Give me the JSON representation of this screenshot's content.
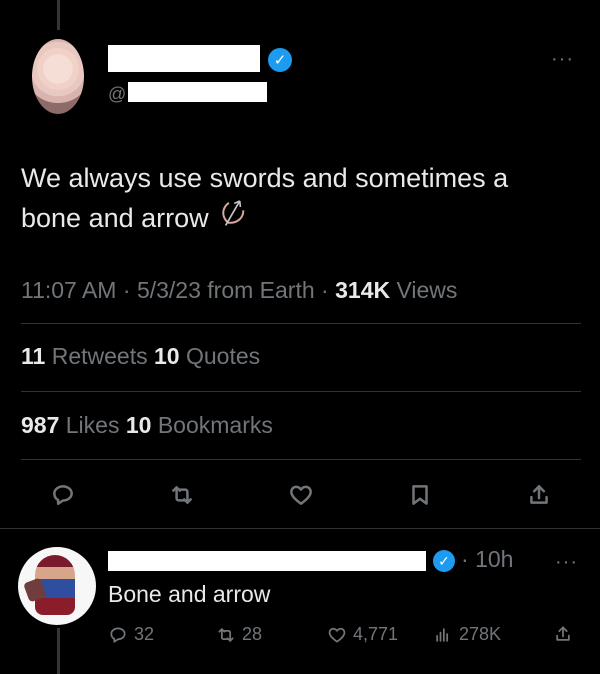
{
  "tweet": {
    "handle_prefix": "@",
    "text_line1": "We always use swords and sometimes a",
    "text_line2": "bone and arrow",
    "time": "11:07 AM",
    "date": "5/3/23",
    "location": "from Earth",
    "views_count": "314K",
    "views_label": "Views",
    "retweets_count": "11",
    "retweets_label": "Retweets",
    "quotes_count": "10",
    "quotes_label": "Quotes",
    "likes_count": "987",
    "likes_label": "Likes",
    "bookmarks_count": "10",
    "bookmarks_label": "Bookmarks",
    "verified_color": "#1d9bf0"
  },
  "reply": {
    "time": "10h",
    "text": "Bone and arrow",
    "replies": "32",
    "retweets": "28",
    "likes": "4,771",
    "views": "278K"
  },
  "icons": {
    "main_actions": [
      "reply-icon",
      "retweet-icon",
      "like-icon",
      "bookmark-icon",
      "share-icon"
    ],
    "emoji": "bow-and-arrow-emoji",
    "more": "more-icon"
  }
}
